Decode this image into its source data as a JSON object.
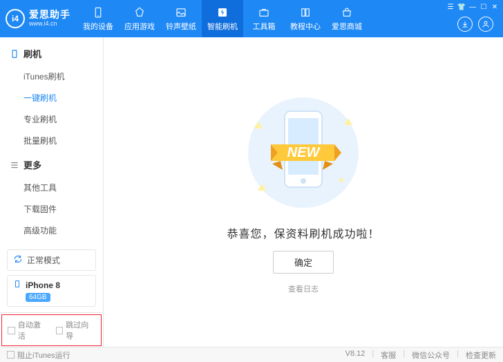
{
  "brand": {
    "logo_text": "i4",
    "name": "爱思助手",
    "url": "www.i4.cn"
  },
  "nav": {
    "items": [
      {
        "label": "我的设备"
      },
      {
        "label": "应用游戏"
      },
      {
        "label": "铃声壁纸"
      },
      {
        "label": "智能刷机"
      },
      {
        "label": "工具箱"
      },
      {
        "label": "教程中心"
      },
      {
        "label": "爱思商城"
      }
    ]
  },
  "sidebar": {
    "flash": {
      "title": "刷机",
      "items": [
        {
          "label": "iTunes刷机"
        },
        {
          "label": "一键刷机"
        },
        {
          "label": "专业刷机"
        },
        {
          "label": "批量刷机"
        }
      ]
    },
    "more": {
      "title": "更多",
      "items": [
        {
          "label": "其他工具"
        },
        {
          "label": "下载固件"
        },
        {
          "label": "高级功能"
        }
      ]
    },
    "mode_label": "正常模式",
    "device_name": "iPhone 8",
    "device_badge": "64GB",
    "opt_auto_activate": "自动激活",
    "opt_skip_guide": "跳过向导"
  },
  "main": {
    "new_label": "NEW",
    "success_text": "恭喜您，保资料刷机成功啦！",
    "confirm_btn": "确定",
    "view_log": "查看日志"
  },
  "footer": {
    "block_itunes": "阻止iTunes运行",
    "version": "V8.12",
    "support": "客服",
    "wechat": "微信公众号",
    "update": "检查更新"
  }
}
